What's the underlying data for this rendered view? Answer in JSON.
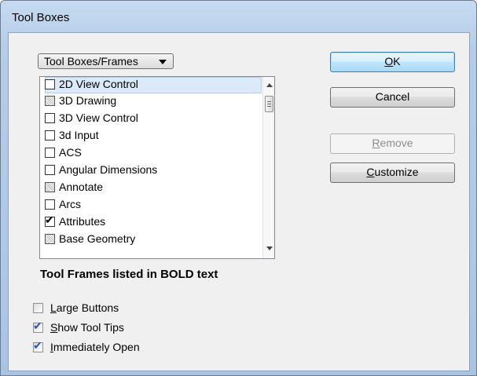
{
  "window": {
    "title": "Tool Boxes"
  },
  "dropdown": {
    "selected": "Tool Boxes/Frames"
  },
  "list": {
    "items": [
      {
        "label": "2D View Control",
        "checked": false,
        "style": "plain",
        "selected": true
      },
      {
        "label": "3D Drawing",
        "checked": false,
        "style": "hatched",
        "selected": false
      },
      {
        "label": "3D View Control",
        "checked": false,
        "style": "plain",
        "selected": false
      },
      {
        "label": "3d Input",
        "checked": false,
        "style": "plain",
        "selected": false
      },
      {
        "label": "ACS",
        "checked": false,
        "style": "plain",
        "selected": false
      },
      {
        "label": "Angular Dimensions",
        "checked": false,
        "style": "plain",
        "selected": false
      },
      {
        "label": "Annotate",
        "checked": false,
        "style": "hatched",
        "selected": false
      },
      {
        "label": "Arcs",
        "checked": false,
        "style": "plain",
        "selected": false
      },
      {
        "label": "Attributes",
        "checked": true,
        "style": "plain",
        "selected": false
      },
      {
        "label": "Base Geometry",
        "checked": false,
        "style": "hatched",
        "selected": false
      }
    ]
  },
  "note": "Tool Frames listed in BOLD text",
  "buttons": {
    "ok": {
      "mnemonic": "O",
      "rest": "K"
    },
    "cancel": {
      "label": "Cancel"
    },
    "remove": {
      "mnemonic": "R",
      "rest": "emove",
      "disabled": true
    },
    "customize": {
      "mnemonic": "C",
      "rest": "ustomize"
    }
  },
  "options": [
    {
      "mnemonic": "L",
      "rest": "arge Buttons",
      "checked": false
    },
    {
      "mnemonic": "S",
      "rest": "how Tool Tips",
      "checked": true
    },
    {
      "mnemonic": "I",
      "rest": "mmediately Open",
      "checked": true
    }
  ],
  "colors": {
    "title_bar": "#b9d1ea",
    "selection": "#dbe9f8",
    "dialog_bg": "#f0f0f0",
    "check_blue": "#2a5aa8"
  },
  "icons": {
    "check": "✔",
    "dropdown_arrow": "triangle-down",
    "scroll_up": "triangle-up",
    "scroll_down": "triangle-down"
  }
}
